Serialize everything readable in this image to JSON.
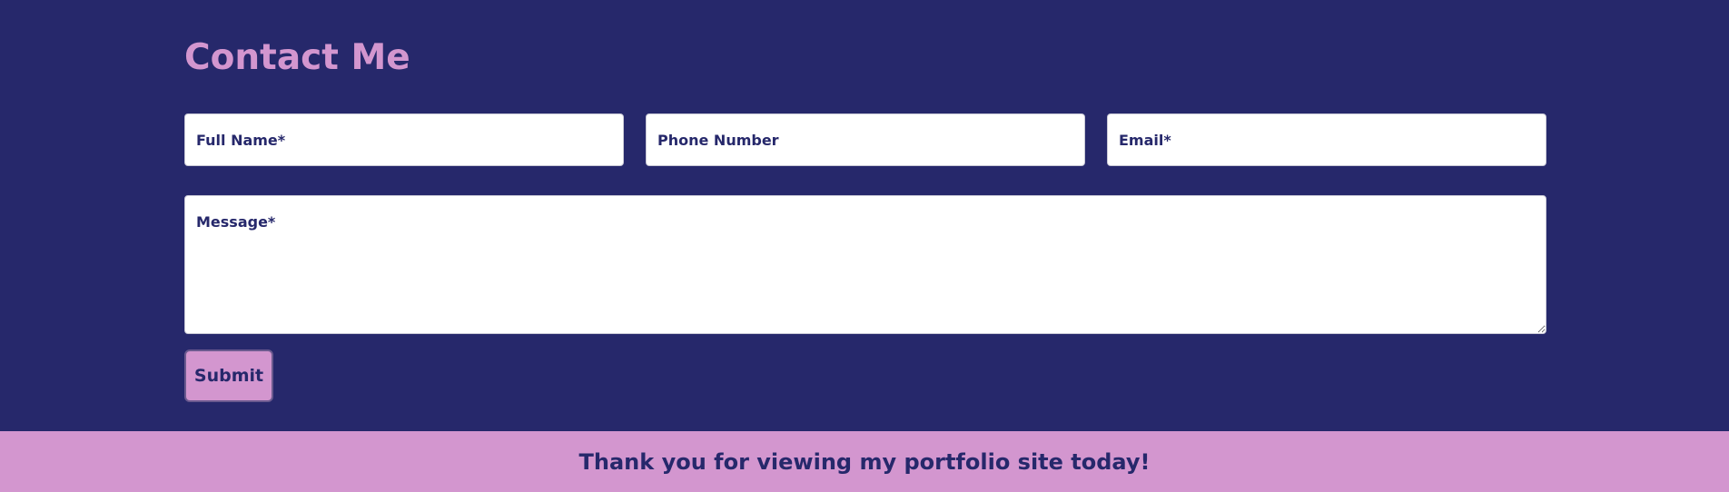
{
  "contact": {
    "title": "Contact Me",
    "fields": {
      "full_name_placeholder": "Full Name*",
      "phone_placeholder": "Phone Number",
      "email_placeholder": "Email*",
      "message_placeholder": "Message*"
    },
    "submit_label": "Submit"
  },
  "footer": {
    "text": "Thank you for viewing my portfolio site today!"
  },
  "colors": {
    "background": "#26286b",
    "accent": "#d396cf",
    "field_background": "#ffffff"
  }
}
